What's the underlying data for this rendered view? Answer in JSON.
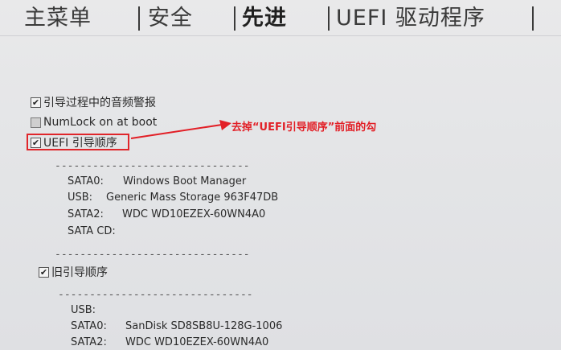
{
  "tabs": [
    {
      "label": "主菜单",
      "active": false
    },
    {
      "label": "安全",
      "active": false
    },
    {
      "label": "先进",
      "active": true
    },
    {
      "label": "UEFI 驱动程序",
      "active": false
    }
  ],
  "options": [
    {
      "label": "引导过程中的音频警报",
      "checked": true
    },
    {
      "label": "NumLock on at boot",
      "checked": false
    },
    {
      "label": "UEFI 引导顺序",
      "checked": true
    }
  ],
  "separator": "-------------------------------",
  "uefi_devices": [
    {
      "key": "SATA0:",
      "value": "Windows Boot Manager"
    },
    {
      "key": "USB:",
      "value": "Generic Mass Storage 963F47DB"
    },
    {
      "key": "SATA2:",
      "value": "WDC WD10EZEX-60WN4A0"
    },
    {
      "key": "SATA CD:",
      "value": ""
    }
  ],
  "legacy": {
    "label": "旧引导顺序",
    "checked": true
  },
  "legacy_devices": [
    {
      "key": "USB:",
      "value": ""
    },
    {
      "key": "SATA0:",
      "value": "SanDisk SD8SB8U-128G-1006"
    },
    {
      "key": "SATA2:",
      "value": "WDC WD10EZEX-60WN4A0"
    }
  ],
  "annotation": {
    "text": "去掉“UEFI引导顺序”前面的勾",
    "color": "#e21f26"
  },
  "colors": {
    "background": "#e4e5e7",
    "highlight": "#e0262b"
  }
}
